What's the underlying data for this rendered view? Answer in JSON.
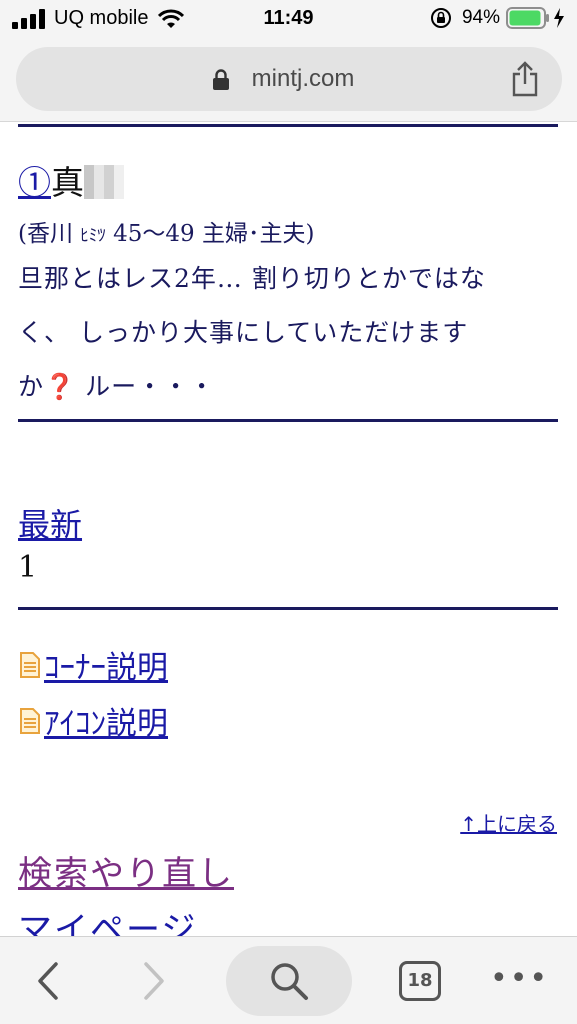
{
  "status_bar": {
    "carrier": "UQ mobile",
    "time": "11:49",
    "battery_percent": "94%",
    "battery_level": 0.94,
    "icons": [
      "signal-icon",
      "wifi-icon",
      "orientation-lock-icon",
      "battery-icon",
      "charging-icon"
    ]
  },
  "browser": {
    "url": "mintj.com",
    "tab_count": "18",
    "icons": [
      "lock-icon",
      "share-icon",
      "back-icon",
      "forward-icon",
      "search-icon",
      "tabs-icon",
      "more-icon"
    ]
  },
  "entry": {
    "number": "①",
    "name": "真",
    "meta_open": "(香川 ",
    "meta_kana": "ﾋﾐﾂ",
    "meta_rest": " 45～49 主婦･主夫)",
    "body_line1": "旦那とはレス2年… 割り切りとかではな",
    "body_line2": "く、 しっかり大事にしていただけます",
    "body_line3_start": "か",
    "body_qmark": "❓",
    "body_line3_end": " ルー・・・"
  },
  "pager": {
    "latest_label": "最新",
    "page_number": "1"
  },
  "links": {
    "corner_help": "ｺｰﾅｰ説明",
    "icon_help": "ｱｲｺﾝ説明",
    "back_to_top_arrow": "↑",
    "back_to_top": "上に戻る",
    "search_again": "検索やり直し",
    "my_page": "マイページ"
  },
  "colors": {
    "link": "#1a1aa6",
    "visited_link": "#7b2f83",
    "rule": "#1a1a5e",
    "battery": "#4cd964",
    "doc_icon": "#e8a33d"
  }
}
